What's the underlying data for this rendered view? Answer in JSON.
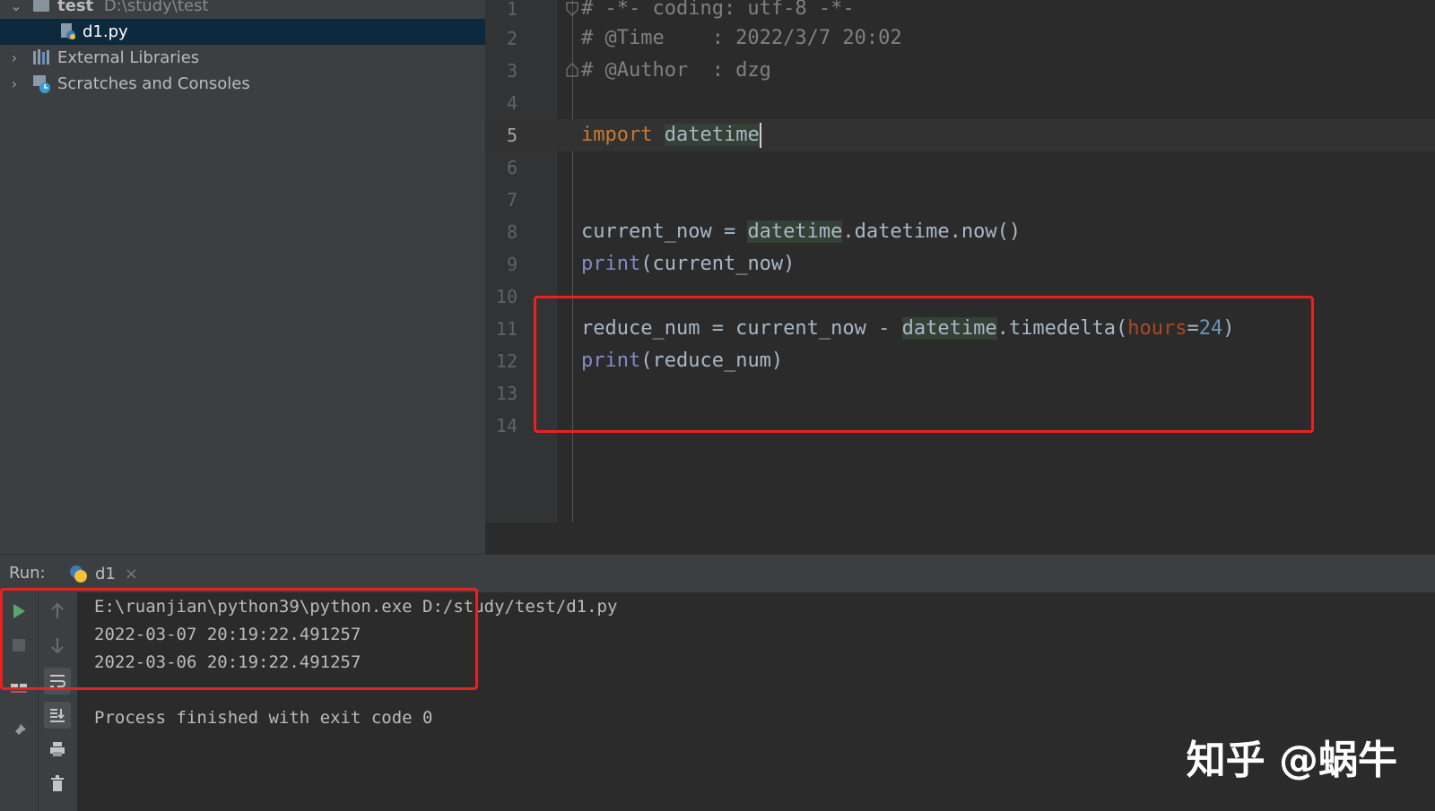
{
  "project_tree": {
    "root": {
      "name": "test",
      "path": "D:\\study\\test"
    },
    "file": {
      "name": "d1.py"
    },
    "external_libraries": "External Libraries",
    "scratches": "Scratches and Consoles"
  },
  "editor": {
    "lines": {
      "l1": "1",
      "l2": "2",
      "l3": "3",
      "l4": "4",
      "l5": "5",
      "l6": "6",
      "l7": "7",
      "l8": "8",
      "l9": "9",
      "l10": "10",
      "l11": "11",
      "l12": "12",
      "l13": "13",
      "l14": "14"
    },
    "code": {
      "c1": "# -*- coding: utf-8 -*-",
      "c2": "# @Time    : 2022/3/7 20:02",
      "c3": "# @Author  : dzg",
      "c5_kw": "import",
      "c5_mod": "datetime",
      "c8_a": "current_now = ",
      "c8_mod": "datetime",
      "c8_b": ".datetime.now()",
      "c9_fn": "print",
      "c9_b": "(current_now)",
      "c11_a": "reduce_num = current_now - ",
      "c11_mod": "datetime",
      "c11_b": ".timedelta(",
      "c11_param": "hours",
      "c11_eq": "=",
      "c11_num": "24",
      "c11_close": ")",
      "c12_fn": "print",
      "c12_b": "(reduce_num)"
    }
  },
  "run_panel": {
    "label": "Run:",
    "tab_name": "d1",
    "close_glyph": "×",
    "console": {
      "cmd": "E:\\ruanjian\\python39\\python.exe D:/study/test/d1.py",
      "out1": "2022-03-07 20:19:22.491257",
      "out2": "2022-03-06 20:19:22.491257",
      "exit": "Process finished with exit code 0"
    }
  },
  "watermark": "知乎 @蜗牛",
  "colors": {
    "highlight_box": "#e8231f",
    "keyword": "#cc7832",
    "builtin": "#8888c6",
    "number": "#6897bb",
    "param": "#aa4926"
  }
}
